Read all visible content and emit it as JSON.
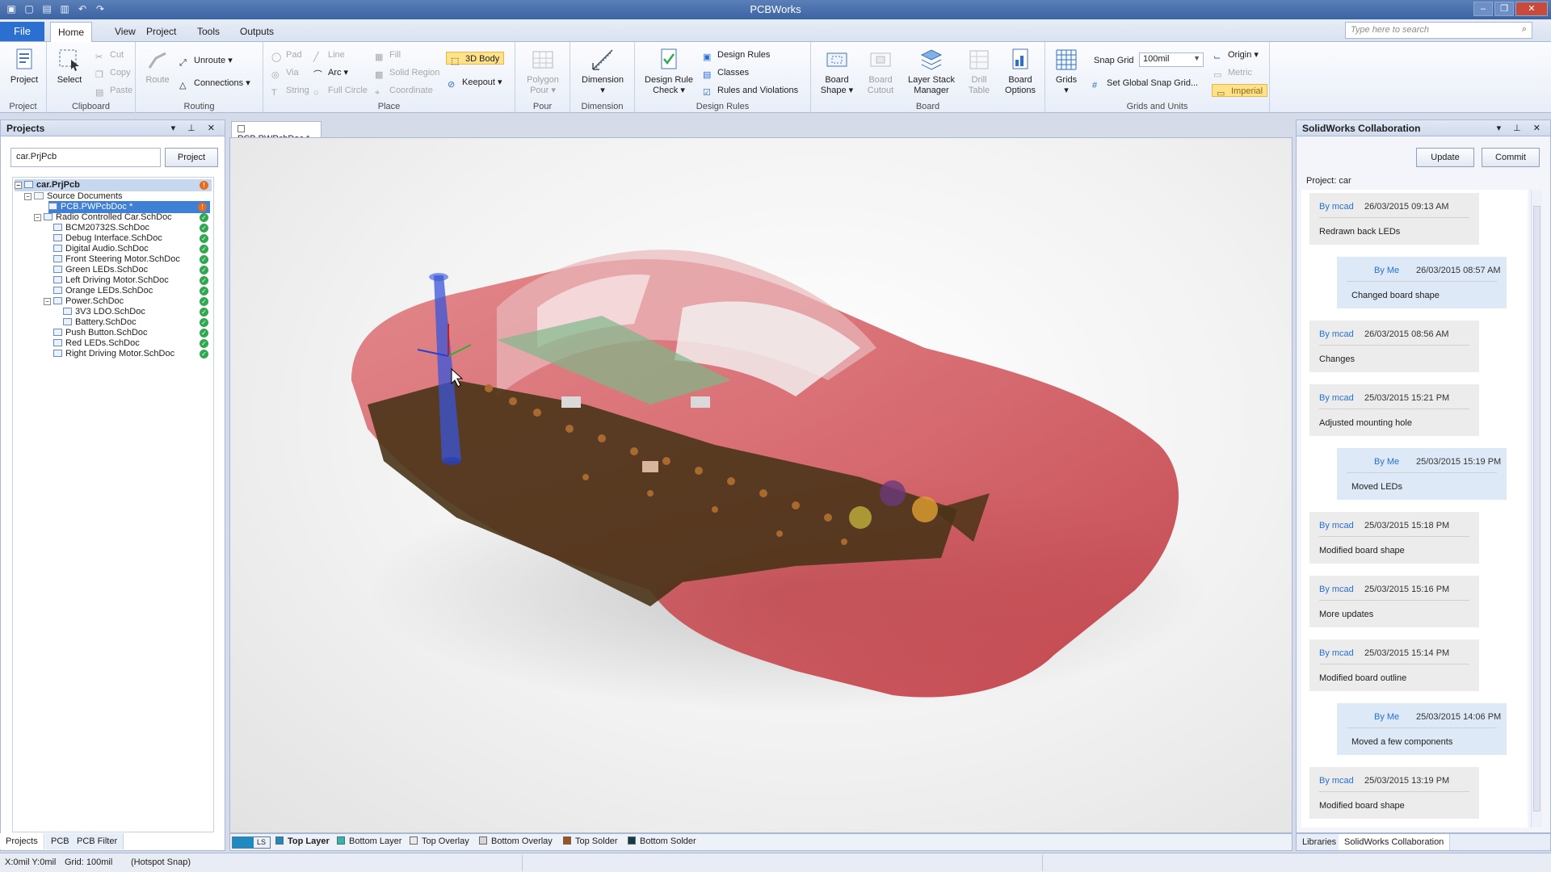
{
  "app": {
    "title": "PCBWorks"
  },
  "ribbon_tabs": {
    "file": "File",
    "home": "Home",
    "view": "View",
    "project": "Project",
    "tools": "Tools",
    "outputs": "Outputs"
  },
  "search": {
    "placeholder": "Type here to search"
  },
  "ribbon": {
    "project_group": {
      "label": "Project",
      "project": "Project"
    },
    "clipboard_group": {
      "label": "Clipboard",
      "select": "Select",
      "cut": "Cut",
      "copy": "Copy",
      "paste": "Paste"
    },
    "routing_group": {
      "label": "Routing",
      "route": "Route",
      "unroute": "Unroute",
      "connections": "Connections"
    },
    "place_group": {
      "label": "Place",
      "pad": "Pad",
      "via": "Via",
      "string": "String",
      "line": "Line",
      "arc": "Arc",
      "full_circle": "Full Circle",
      "fill": "Fill",
      "solid_region": "Solid Region",
      "coordinate": "Coordinate",
      "body_3d": "3D Body",
      "keepout": "Keepout"
    },
    "pour_group": {
      "label": "Pour",
      "polygon_pour_1": "Polygon",
      "polygon_pour_2": "Pour"
    },
    "dimension_group": {
      "label": "Dimension",
      "dimension": "Dimension"
    },
    "design_rules_group": {
      "label": "Design Rules",
      "drc_1": "Design Rule",
      "drc_2": "Check",
      "design_rules": "Design Rules",
      "classes": "Classes",
      "rules_violations": "Rules and Violations"
    },
    "board_group": {
      "label": "Board",
      "board_shape_1": "Board",
      "board_shape_2": "Shape",
      "board_cutout_1": "Board",
      "board_cutout_2": "Cutout",
      "layer_stack_1": "Layer Stack",
      "layer_stack_2": "Manager",
      "drill_table_1": "Drill",
      "drill_table_2": "Table",
      "board_options_1": "Board",
      "board_options_2": "Options"
    },
    "grids_group": {
      "label": "Grids and Units",
      "grids": "Grids",
      "snap_grid_label": "Snap Grid",
      "snap_grid_value": "100mil",
      "set_global": "Set Global Snap Grid...",
      "origin": "Origin",
      "metric": "Metric",
      "imperial": "Imperial"
    }
  },
  "projects_panel": {
    "title": "Projects",
    "project_field": "car.PrjPcb",
    "project_button": "Project",
    "tree": {
      "root": "car.PrjPcb",
      "source": "Source Documents",
      "pcb": "PCB.PWPcbDoc *",
      "rc_car": "Radio Controlled Car.SchDoc",
      "bcm": "BCM20732S.SchDoc",
      "debug": "Debug Interface.SchDoc",
      "audio": "Digital Audio.SchDoc",
      "front": "Front Steering Motor.SchDoc",
      "green": "Green LEDs.SchDoc",
      "left": "Left Driving Motor.SchDoc",
      "orange": "Orange LEDs.SchDoc",
      "power": "Power.SchDoc",
      "ldo": "3V3 LDO.SchDoc",
      "battery": "Battery.SchDoc",
      "push": "Push Button.SchDoc",
      "red": "Red LEDs.SchDoc",
      "right": "Right Driving Motor.SchDoc"
    },
    "tabs": {
      "projects": "Projects",
      "pcb": "PCB",
      "pcb_filter": "PCB Filter"
    }
  },
  "document": {
    "tab": "PCB.PWPcbDoc *"
  },
  "layers": {
    "ls": "LS",
    "top": "Top Layer",
    "bottom": "Bottom Layer",
    "top_overlay": "Top Overlay",
    "bottom_overlay": "Bottom Overlay",
    "top_solder": "Top Solder",
    "bottom_solder": "Bottom Solder"
  },
  "collab_panel": {
    "title": "SolidWorks Collaboration",
    "update": "Update",
    "commit": "Commit",
    "project": "Project: car",
    "entries": [
      {
        "by": "By mcad",
        "date": "26/03/2015 09:13 AM",
        "msg": "Redrawn back LEDs"
      },
      {
        "by": "By Me",
        "date": "26/03/2015 08:57 AM",
        "msg": "Changed board shape"
      },
      {
        "by": "By mcad",
        "date": "26/03/2015 08:56 AM",
        "msg": "Changes"
      },
      {
        "by": "By mcad",
        "date": "25/03/2015 15:21 PM",
        "msg": "Adjusted mounting hole"
      },
      {
        "by": "By Me",
        "date": "25/03/2015 15:19 PM",
        "msg": "Moved LEDs"
      },
      {
        "by": "By mcad",
        "date": "25/03/2015 15:18 PM",
        "msg": "Modified board shape"
      },
      {
        "by": "By mcad",
        "date": "25/03/2015 15:16 PM",
        "msg": "More updates"
      },
      {
        "by": "By mcad",
        "date": "25/03/2015 15:14 PM",
        "msg": "Modified board outline"
      },
      {
        "by": "By Me",
        "date": "25/03/2015 14:06 PM",
        "msg": "Moved a few components"
      },
      {
        "by": "By mcad",
        "date": "25/03/2015 13:19 PM",
        "msg": "Modified board shape"
      }
    ],
    "tabs": {
      "libraries": "Libraries",
      "collab": "SolidWorks Collaboration"
    }
  },
  "statusbar": {
    "coords": "X:0mil Y:0mil",
    "grid": "Grid: 100mil",
    "snap": "(Hotspot Snap)"
  },
  "colors": {
    "accent": "#2a6fd1",
    "car_body": "#c8202a",
    "board": "#4a3418",
    "top_layer": "#1f8ac0",
    "bottom_layer": "#2fb8b0",
    "top_solder": "#a0521a",
    "bottom_solder": "#0f3d4c"
  }
}
